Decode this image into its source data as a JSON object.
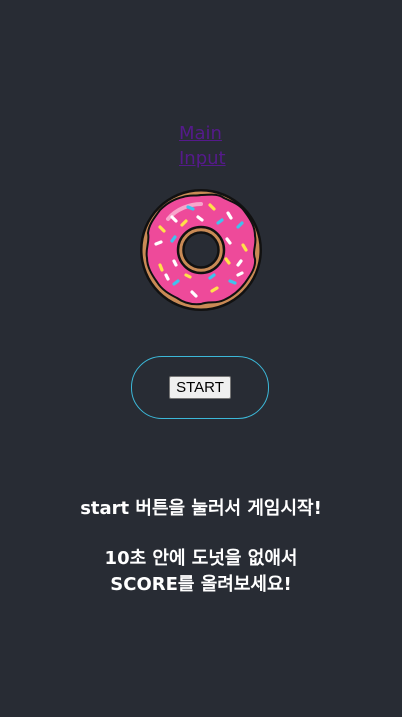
{
  "nav": {
    "main_link": "Main",
    "input_link": "Input"
  },
  "image": {
    "icon": "donut-icon",
    "colors": {
      "frosting": "#ee4a9a",
      "dough": "#c98a55",
      "outline": "#111111"
    }
  },
  "game": {
    "start_label": "START",
    "instruction": "start 버튼을 눌러서 게임시작!",
    "goal_line1": "10초 안에 도넛을 없애서",
    "goal_line2": "SCORE를 올려보세요!"
  },
  "colors": {
    "background": "#282c34",
    "button_border": "#3cb8d8",
    "text": "#ffffff",
    "link": "#551a8b"
  }
}
